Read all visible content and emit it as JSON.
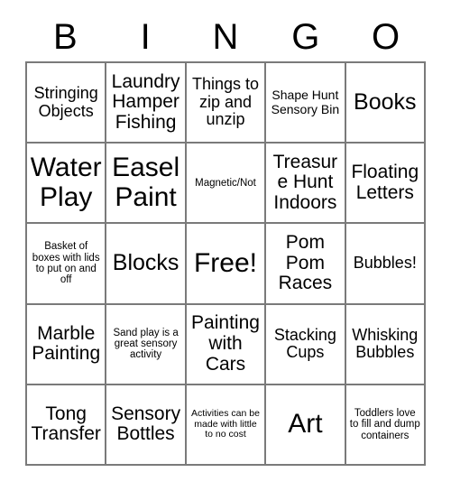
{
  "card": {
    "title": "BINGO",
    "header_letters": [
      "B",
      "I",
      "N",
      "G",
      "O"
    ],
    "grid_size": "5x5",
    "free_space_index": 12,
    "colors": {
      "background": "#ffffff",
      "text": "#000000",
      "grid_line": "#7a7a7a"
    },
    "cells": [
      {
        "id": "cell-b1",
        "column": "B",
        "row": 1,
        "text": "Stringing Objects",
        "size": "md",
        "free": false
      },
      {
        "id": "cell-i1",
        "column": "I",
        "row": 1,
        "text": "Laundry Hamper Fishing",
        "size": "lg",
        "free": false
      },
      {
        "id": "cell-n1",
        "column": "N",
        "row": 1,
        "text": "Things to zip and unzip",
        "size": "md",
        "free": false
      },
      {
        "id": "cell-g1",
        "column": "G",
        "row": 1,
        "text": "Shape Hunt Sensory Bin",
        "size": "sm",
        "free": false
      },
      {
        "id": "cell-o1",
        "column": "O",
        "row": 1,
        "text": "Books",
        "size": "xl",
        "free": false
      },
      {
        "id": "cell-b2",
        "column": "B",
        "row": 2,
        "text": "Water Play",
        "size": "xxl",
        "free": false
      },
      {
        "id": "cell-i2",
        "column": "I",
        "row": 2,
        "text": "Easel Paint",
        "size": "xxl",
        "free": false
      },
      {
        "id": "cell-n2",
        "column": "N",
        "row": 2,
        "text": "Magnetic/Not",
        "size": "xs",
        "free": false
      },
      {
        "id": "cell-g2",
        "column": "G",
        "row": 2,
        "text": "Treasure Hunt Indoors",
        "size": "lg",
        "free": false
      },
      {
        "id": "cell-o2",
        "column": "O",
        "row": 2,
        "text": "Floating Letters",
        "size": "lg",
        "free": false
      },
      {
        "id": "cell-b3",
        "column": "B",
        "row": 3,
        "text": "Basket of boxes with lids to put on and off",
        "size": "xs",
        "free": false
      },
      {
        "id": "cell-i3",
        "column": "I",
        "row": 3,
        "text": "Blocks",
        "size": "xl",
        "free": false
      },
      {
        "id": "cell-n3",
        "column": "N",
        "row": 3,
        "text": "Free!",
        "size": "xxl",
        "free": true
      },
      {
        "id": "cell-g3",
        "column": "G",
        "row": 3,
        "text": "Pom Pom Races",
        "size": "lg",
        "free": false
      },
      {
        "id": "cell-o3",
        "column": "O",
        "row": 3,
        "text": "Bubbles!",
        "size": "md",
        "free": false
      },
      {
        "id": "cell-b4",
        "column": "B",
        "row": 4,
        "text": "Marble Painting",
        "size": "lg",
        "free": false
      },
      {
        "id": "cell-i4",
        "column": "I",
        "row": 4,
        "text": "Sand play is a great sensory activity",
        "size": "xs",
        "free": false
      },
      {
        "id": "cell-n4",
        "column": "N",
        "row": 4,
        "text": "Painting with Cars",
        "size": "lg",
        "free": false
      },
      {
        "id": "cell-g4",
        "column": "G",
        "row": 4,
        "text": "Stacking Cups",
        "size": "md",
        "free": false
      },
      {
        "id": "cell-o4",
        "column": "O",
        "row": 4,
        "text": "Whisking Bubbles",
        "size": "md",
        "free": false
      },
      {
        "id": "cell-b5",
        "column": "B",
        "row": 5,
        "text": "Tong Transfer",
        "size": "lg",
        "free": false
      },
      {
        "id": "cell-i5",
        "column": "I",
        "row": 5,
        "text": "Sensory Bottles",
        "size": "lg",
        "free": false
      },
      {
        "id": "cell-n5",
        "column": "N",
        "row": 5,
        "text": "Activities can be made with little to no cost",
        "size": "xxs",
        "free": false
      },
      {
        "id": "cell-g5",
        "column": "G",
        "row": 5,
        "text": "Art",
        "size": "xxl",
        "free": false
      },
      {
        "id": "cell-o5",
        "column": "O",
        "row": 5,
        "text": "Toddlers love to fill and dump containers",
        "size": "xs",
        "free": false
      }
    ]
  }
}
